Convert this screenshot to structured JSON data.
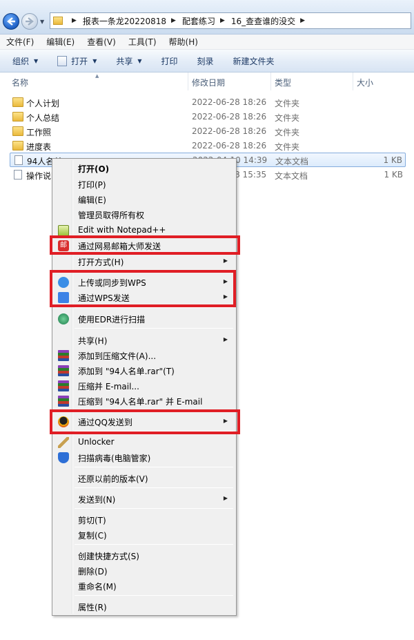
{
  "breadcrumb": [
    "报表一条龙20220818",
    "配套练习",
    "16_查查谁的没交"
  ],
  "menubar": [
    "文件(F)",
    "编辑(E)",
    "查看(V)",
    "工具(T)",
    "帮助(H)"
  ],
  "commands": {
    "organize": "组织",
    "open": "打开",
    "share": "共享",
    "print": "打印",
    "burn": "刻录",
    "new_folder": "新建文件夹"
  },
  "columns": {
    "name": "名称",
    "date": "修改日期",
    "type": "类型",
    "size": "大小"
  },
  "files": [
    {
      "name": "个人计划",
      "date": "2022-06-28 18:26",
      "type": "文件夹",
      "size": "",
      "kind": "folder"
    },
    {
      "name": "个人总结",
      "date": "2022-06-28 18:26",
      "type": "文件夹",
      "size": "",
      "kind": "folder"
    },
    {
      "name": "工作照",
      "date": "2022-06-28 18:26",
      "type": "文件夹",
      "size": "",
      "kind": "folder"
    },
    {
      "name": "进度表",
      "date": "2022-06-28 18:26",
      "type": "文件夹",
      "size": "",
      "kind": "folder"
    },
    {
      "name": "94人名单",
      "date": "2022-04-10 14:39",
      "type": "文本文档",
      "size": "1 KB",
      "kind": "doc",
      "selected": true
    },
    {
      "name": "操作说明",
      "date": "2022-06-28 15:35",
      "type": "文本文档",
      "size": "1 KB",
      "kind": "doc"
    }
  ],
  "context_menu": {
    "open": "打开(O)",
    "print": "打印(P)",
    "edit": "编辑(E)",
    "take_ownership": "管理员取得所有权",
    "notepadpp": "Edit with Notepad++",
    "send_netease_mail": "通过网易邮箱大师发送",
    "open_with": "打开方式(H)",
    "upload_wps": "上传或同步到WPS",
    "send_wps": "通过WPS发送",
    "scan_edr": "使用EDR进行扫描",
    "share": "共享(H)",
    "add_archive": "添加到压缩文件(A)...",
    "add_to_rar": "添加到 \"94人名单.rar\"(T)",
    "compress_email": "压缩并 E-mail...",
    "compress_rar_email": "压缩到 \"94人名单.rar\" 并 E-mail",
    "send_qq": "通过QQ发送到",
    "unlocker": "Unlocker",
    "scan_virus": "扫描病毒(电脑管家)",
    "restore_versions": "还原以前的版本(V)",
    "send_to": "发送到(N)",
    "cut": "剪切(T)",
    "copy": "复制(C)",
    "create_shortcut": "创建快捷方式(S)",
    "delete": "删除(D)",
    "rename": "重命名(M)",
    "properties": "属性(R)"
  },
  "icons": {
    "mail": "邮",
    "highlight_color": "#e01e25"
  }
}
